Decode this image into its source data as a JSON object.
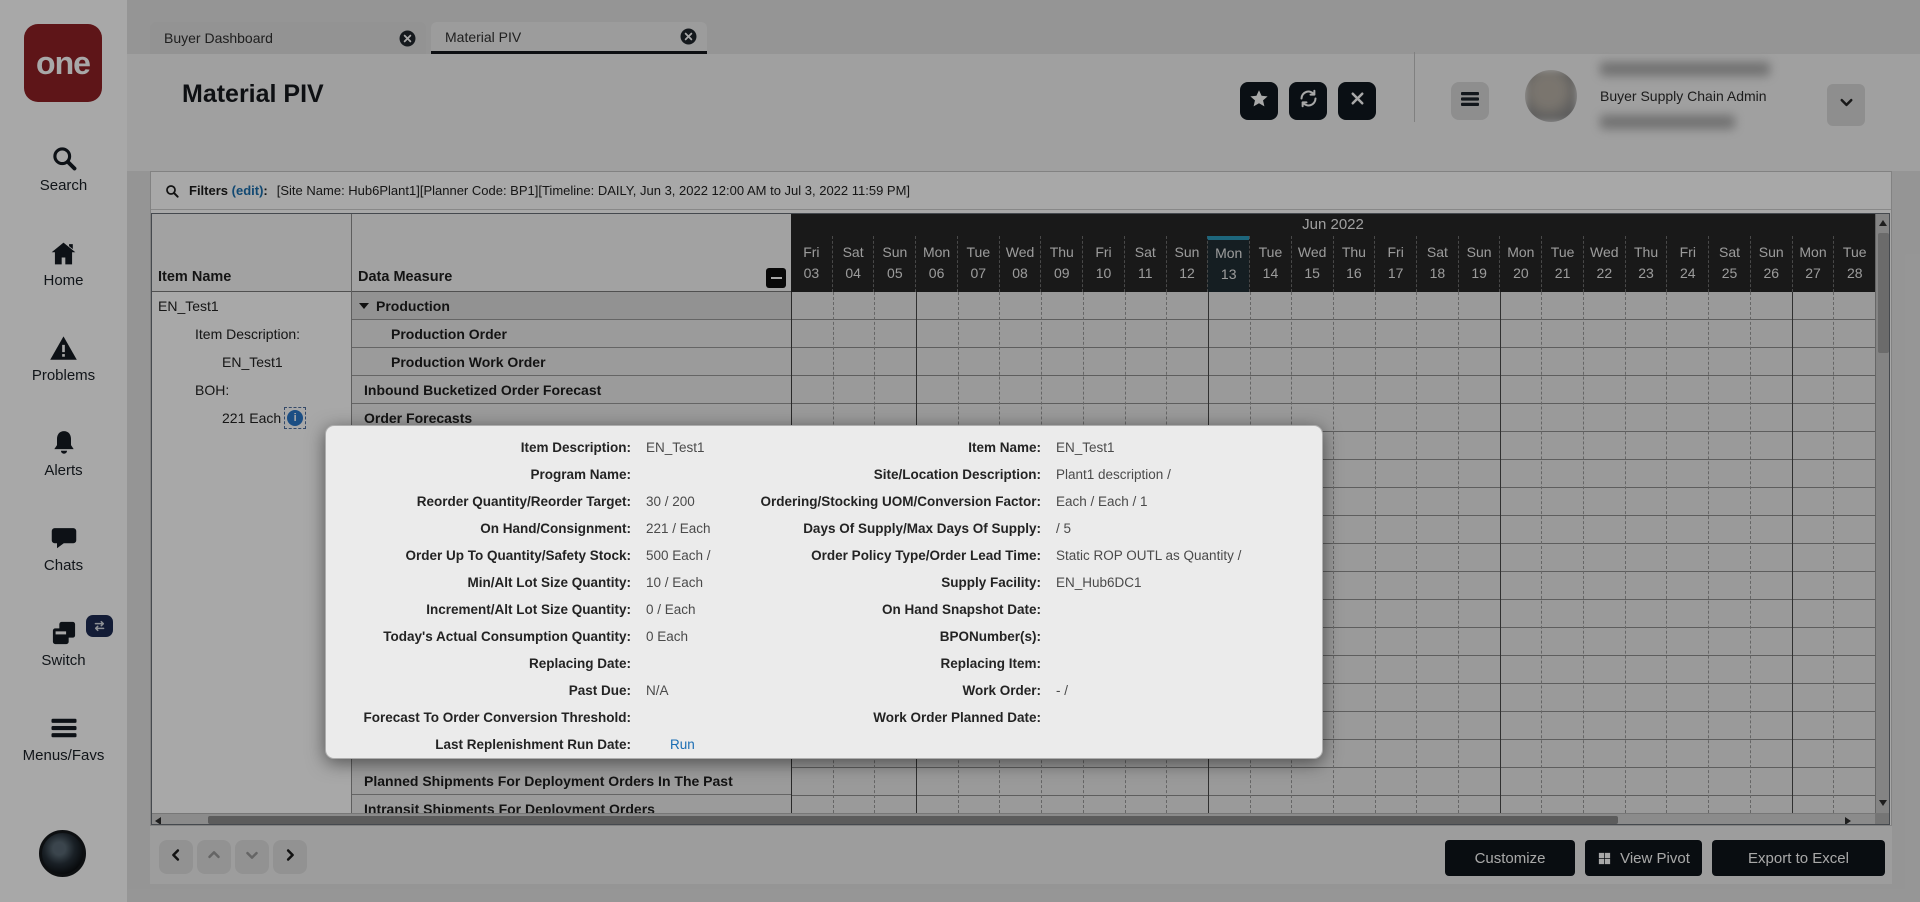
{
  "colors": {
    "brand_maroon": "#8f2025",
    "today_accent_teal": "#2d9cbd",
    "link_blue": "#1b6fb1",
    "dark_button": "#10181f",
    "grid_header_dark": "#262626"
  },
  "sidebar": {
    "logo_text": "one",
    "items": [
      {
        "id": "search",
        "label": "Search",
        "icon": "search-icon"
      },
      {
        "id": "home",
        "label": "Home",
        "icon": "home-icon"
      },
      {
        "id": "problems",
        "label": "Problems",
        "icon": "warning-triangle-icon"
      },
      {
        "id": "alerts",
        "label": "Alerts",
        "icon": "bell-icon"
      },
      {
        "id": "chats",
        "label": "Chats",
        "icon": "chat-bubble-icon"
      },
      {
        "id": "switch",
        "label": "Switch",
        "icon": "switch-windows-icon",
        "badge_icon": "swap-arrows-icon"
      },
      {
        "id": "menus",
        "label": "Menus/Favs",
        "icon": "hamburger-icon"
      }
    ]
  },
  "tabs": [
    {
      "label": "Buyer Dashboard",
      "active": false
    },
    {
      "label": "Material PIV",
      "active": true
    }
  ],
  "header": {
    "title": "Material PIV",
    "role": "Buyer Supply Chain Admin"
  },
  "filters": {
    "label": "Filters",
    "edit_link": "(edit)",
    "suffix": ":",
    "value": "[Site Name: Hub6Plant1][Planner Code: BP1][Timeline: DAILY, Jun 3, 2022 12:00 AM to Jul 3, 2022 11:59 PM]"
  },
  "grid": {
    "col_item": "Item Name",
    "col_measure": "Data Measure",
    "month": "Jun 2022",
    "today_index": 10,
    "week_start_indexes": [
      3,
      10,
      17,
      24
    ],
    "days": [
      [
        "Fri",
        "03"
      ],
      [
        "Sat",
        "04"
      ],
      [
        "Sun",
        "05"
      ],
      [
        "Mon",
        "06"
      ],
      [
        "Tue",
        "07"
      ],
      [
        "Wed",
        "08"
      ],
      [
        "Thu",
        "09"
      ],
      [
        "Fri",
        "10"
      ],
      [
        "Sat",
        "11"
      ],
      [
        "Sun",
        "12"
      ],
      [
        "Mon",
        "13"
      ],
      [
        "Tue",
        "14"
      ],
      [
        "Wed",
        "15"
      ],
      [
        "Thu",
        "16"
      ],
      [
        "Fri",
        "17"
      ],
      [
        "Sat",
        "18"
      ],
      [
        "Sun",
        "19"
      ],
      [
        "Mon",
        "20"
      ],
      [
        "Tue",
        "21"
      ],
      [
        "Wed",
        "22"
      ],
      [
        "Thu",
        "23"
      ],
      [
        "Fri",
        "24"
      ],
      [
        "Sat",
        "25"
      ],
      [
        "Sun",
        "26"
      ],
      [
        "Mon",
        "27"
      ],
      [
        "Tue",
        "28"
      ]
    ],
    "item": {
      "name": "EN_Test1",
      "desc_label": "Item Description:",
      "desc_value": "EN_Test1",
      "boh_label": "BOH:",
      "boh_value": "221 Each"
    },
    "measures_top": [
      {
        "label": "Production",
        "level": 0,
        "group": true
      },
      {
        "label": "Production Order",
        "level": 1
      },
      {
        "label": "Production Work Order",
        "level": 1
      },
      {
        "label": "Inbound Bucketized Order Forecast",
        "level": 0
      },
      {
        "label": "Order Forecasts",
        "level": 0
      }
    ],
    "measures_bottom": [
      {
        "label": "Planned Shipments For Deployment Orders In The Past",
        "level": 0
      },
      {
        "label": "Intransit Shipments For Deployment Orders",
        "level": 0
      }
    ]
  },
  "popup": {
    "rows": [
      {
        "l1": "Item Description:",
        "v1": "EN_Test1",
        "l2": "Item Name:",
        "v2": "EN_Test1"
      },
      {
        "l1": "Program Name:",
        "v1": "",
        "l2": "Site/Location Description:",
        "v2": "Plant1 description /"
      },
      {
        "l1": "Reorder Quantity/Reorder Target:",
        "v1": "30  / 200",
        "l2": "Ordering/Stocking UOM/Conversion Factor:",
        "v2": "Each / Each / 1"
      },
      {
        "l1": "On Hand/Consignment:",
        "v1": "221 /  Each",
        "l2": "Days Of Supply/Max Days Of Supply:",
        "v2": " / 5"
      },
      {
        "l1": "Order Up To Quantity/Safety Stock:",
        "v1": "500 Each /",
        "l2": "Order Policy Type/Order Lead Time:",
        "v2": "Static ROP OUTL as Quantity /"
      },
      {
        "l1": "Min/Alt Lot Size Quantity:",
        "v1": "10 /  Each",
        "l2": "Supply Facility:",
        "v2": "EN_Hub6DC1"
      },
      {
        "l1": "Increment/Alt Lot Size Quantity:",
        "v1": "0 /  Each",
        "l2": "On Hand Snapshot Date:",
        "v2": ""
      },
      {
        "l1": "Today's Actual Consumption Quantity:",
        "v1": "0 Each",
        "l2": "BPONumber(s):",
        "v2": ""
      },
      {
        "l1": "Replacing Date:",
        "v1": "",
        "l2": "Replacing Item:",
        "v2": ""
      },
      {
        "l1": "Past Due:",
        "v1": "N/A",
        "l2": "Work Order:",
        "v2": "-   /"
      },
      {
        "l1": "Forecast To Order Conversion Threshold:",
        "v1": "",
        "l2": "Work Order Planned Date:",
        "v2": ""
      },
      {
        "l1": "Last Replenishment Run Date:",
        "v1": "Run",
        "run_link": true,
        "l2": "",
        "v2": ""
      }
    ]
  },
  "footer": {
    "customize": "Customize",
    "view_pivot": "View Pivot",
    "export_excel": "Export to Excel"
  }
}
